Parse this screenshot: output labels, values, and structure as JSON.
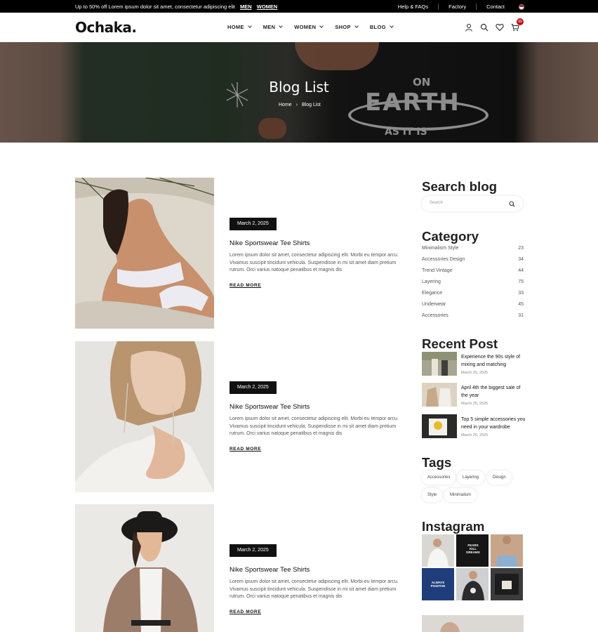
{
  "topbar": {
    "promo": "Up to 50% off Lorem ipsum dolor sit amet, consectetur adipiscing elit",
    "promo_link_men": "MEN",
    "promo_link_women": "WOMEN",
    "links": [
      "Help & FAQs",
      "Factory",
      "Contact"
    ]
  },
  "header": {
    "logo": "Ochaka.",
    "nav": [
      "HOME",
      "MEN",
      "WOMEN",
      "SHOP",
      "BLOG"
    ],
    "cart_count": "99"
  },
  "hero": {
    "title": "Blog List",
    "breadcrumb": [
      "Home",
      "Blog List"
    ],
    "shirt_text": {
      "on": "ON",
      "earth": "EARTH",
      "as_it_is": "AS IT IS"
    }
  },
  "posts": [
    {
      "date": "March 2, 2025",
      "title": "Nike Sportswear Tee Shirts",
      "excerpt": "Lorem ipsum dolor sit amet, consectetur adipiscing elit. Morbi eu tempor arcu. Vivamus suscipit tincidunt vehicula. Suspendisse in mi sit amet diam pretium rutrum. Orci varius natoque penatibus et magnis dis",
      "read_more": "READ MORE"
    },
    {
      "date": "March 2, 2025",
      "title": "Nike Sportswear Tee Shirts",
      "excerpt": "Lorem ipsum dolor sit amet, consectetur adipiscing elit. Morbi eu tempor arcu. Vivamus suscipit tincidunt vehicula. Suspendisse in mi sit amet diam pretium rutrum. Orci varius natoque penatibus et magnis dis",
      "read_more": "READ MORE"
    },
    {
      "date": "March 2, 2025",
      "title": "Nike Sportswear Tee Shirts",
      "excerpt": "Lorem ipsum dolor sit amet, consectetur adipiscing elit. Morbi eu tempor arcu. Vivamus suscipit tincidunt vehicula. Suspendisse in mi sit amet diam pretium rutrum. Orci varius natoque penatibus et magnis dis",
      "read_more": "READ MORE"
    }
  ],
  "sidebar": {
    "search_title": "Search blog",
    "search_placeholder": "Search",
    "category_title": "Category",
    "categories": [
      {
        "name": "Minimalism Style",
        "count": "23"
      },
      {
        "name": "Accessories Design",
        "count": "34"
      },
      {
        "name": "Trend Vintage",
        "count": "44"
      },
      {
        "name": "Layering",
        "count": "75"
      },
      {
        "name": "Elegance",
        "count": "33"
      },
      {
        "name": "Underwear",
        "count": "45"
      },
      {
        "name": "Accessories",
        "count": "31"
      }
    ],
    "recent_title": "Recent Post",
    "recent": [
      {
        "title": "Experience the 90s style of mixing and matching",
        "date": "March 25, 2025"
      },
      {
        "title": "April 4th the biggest sale of the year",
        "date": "March 25, 2025"
      },
      {
        "title": "Top 5 simple accessories you need in your wardrobe",
        "date": "March 25, 2025"
      }
    ],
    "tags_title": "Tags",
    "tags": [
      "Accessories",
      "Layering",
      "Design",
      "Style",
      "Minimalism"
    ],
    "instagram_title": "Instagram",
    "instagram_texts": {
      "tee2": "FEARS KILL DREAMS",
      "tee4": "ALWAYS POSITIVE"
    }
  },
  "colors": {
    "accent": "#111111",
    "badge": "#c0101b",
    "topbar": "#000000"
  }
}
